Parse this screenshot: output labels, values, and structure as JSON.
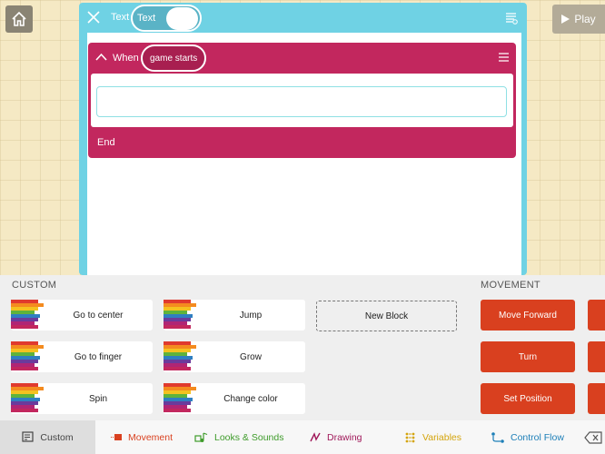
{
  "topbar": {
    "play_label": "Play"
  },
  "editor": {
    "object_type": "Text",
    "object_name": "Text",
    "rule": {
      "when_label": "When",
      "trigger": "game starts",
      "end_label": "End"
    }
  },
  "palette": {
    "custom_title": "CUSTOM",
    "movement_title": "MOVEMENT",
    "custom_blocks": [
      {
        "label": "Go to center"
      },
      {
        "label": "Jump"
      },
      {
        "label": "Go to finger"
      },
      {
        "label": "Grow"
      },
      {
        "label": "Spin"
      },
      {
        "label": "Change color"
      }
    ],
    "new_block_label": "New Block",
    "movement_blocks": [
      {
        "label": "Move Forward"
      },
      {
        "label": "Turn"
      },
      {
        "label": "Set Position"
      }
    ]
  },
  "categories": [
    {
      "label": "Custom",
      "color": "#444444",
      "icon": "custom-icon"
    },
    {
      "label": "Movement",
      "color": "#d9401f",
      "icon": "movement-icon"
    },
    {
      "label": "Looks & Sounds",
      "color": "#3e9b2a",
      "icon": "looks-sounds-icon"
    },
    {
      "label": "Drawing",
      "color": "#a0195a",
      "icon": "drawing-icon"
    },
    {
      "label": "Variables",
      "color": "#d4a40c",
      "icon": "variables-icon"
    },
    {
      "label": "Control Flow",
      "color": "#1d7fb8",
      "icon": "control-flow-icon"
    }
  ],
  "colors": {
    "rule": "#c2275e",
    "editor": "#6fd2e4",
    "movement": "#d9401f"
  }
}
